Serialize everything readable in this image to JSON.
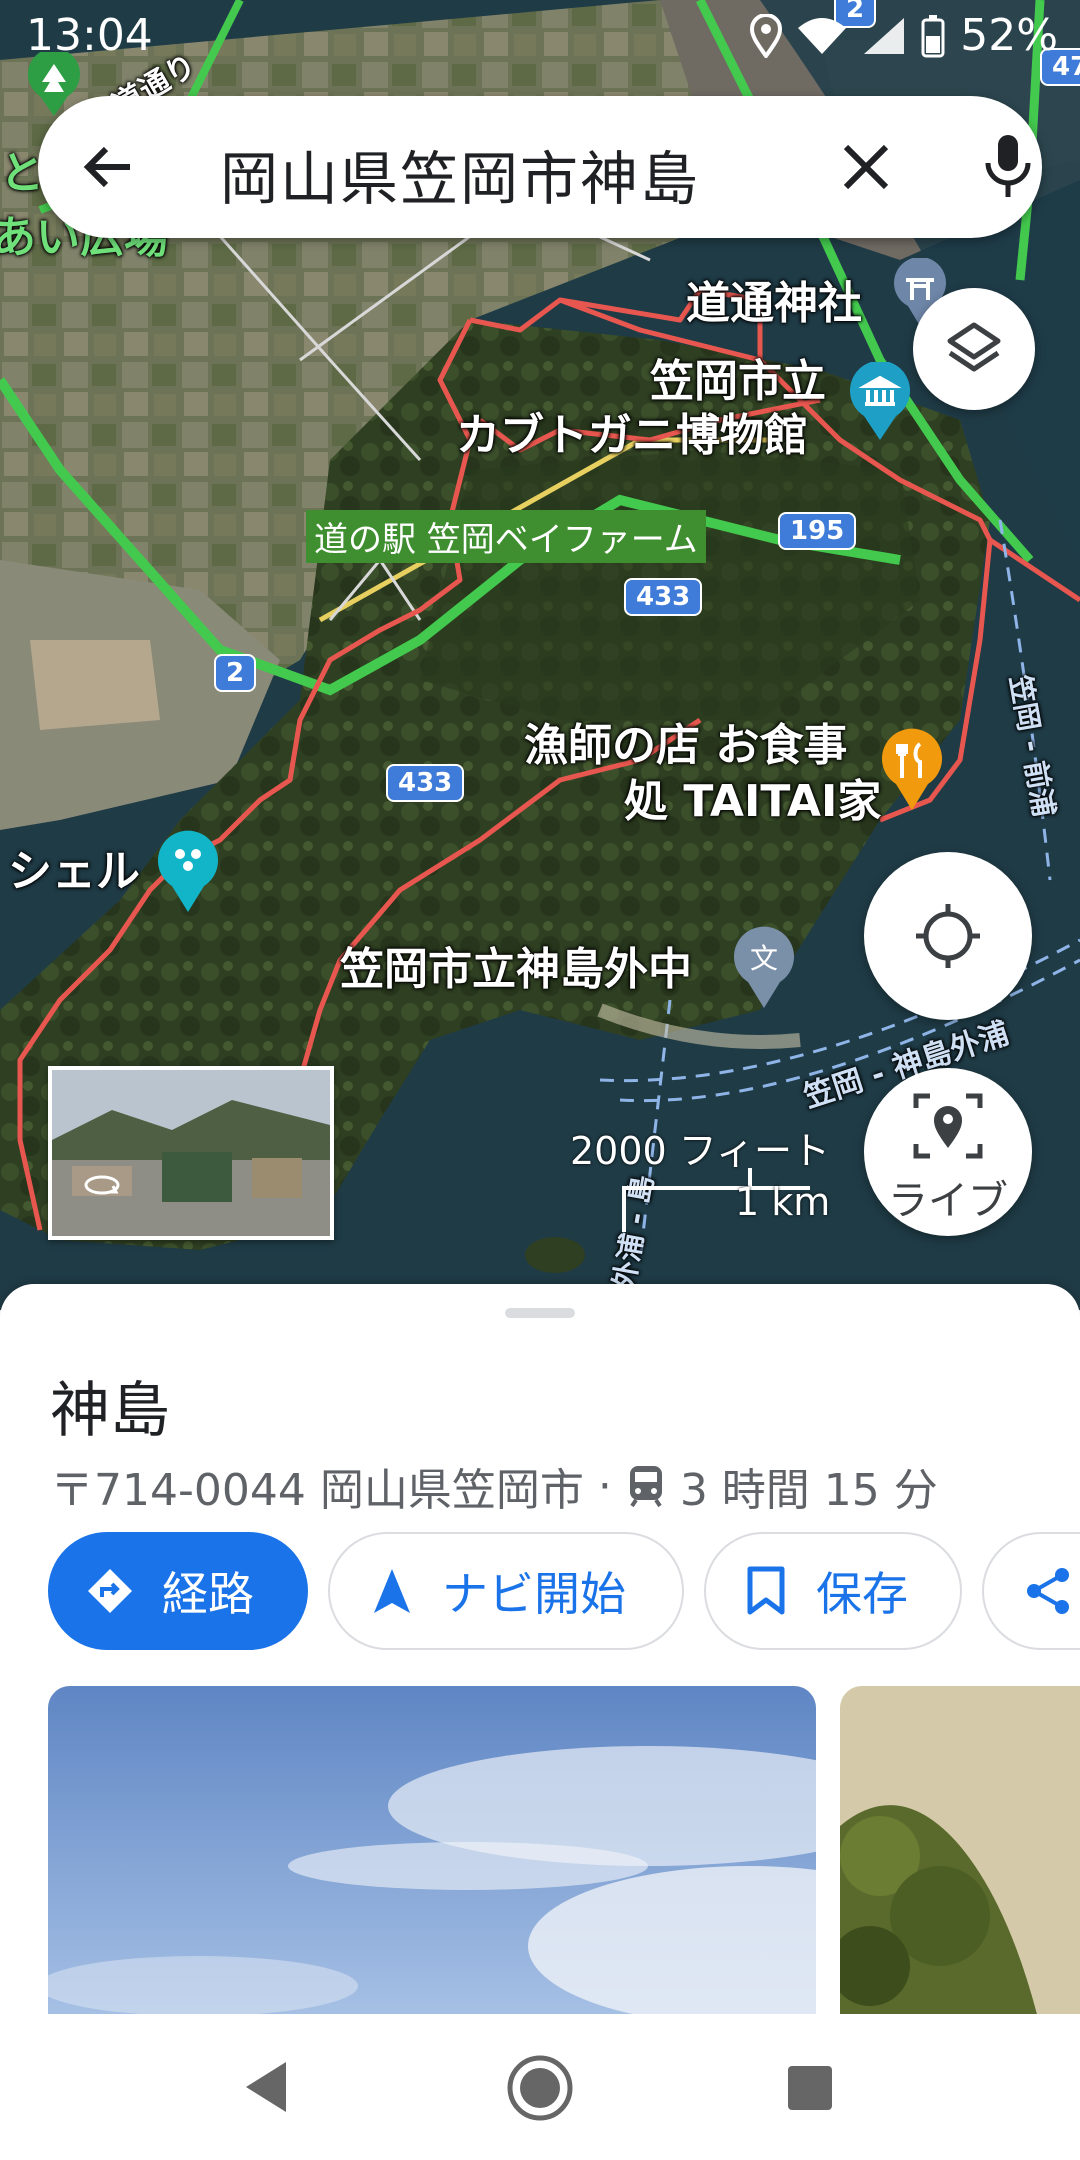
{
  "status_bar": {
    "time": "13:04",
    "battery": "52%"
  },
  "search": {
    "query": "岡山県笠岡市神島"
  },
  "map": {
    "labels": {
      "shrine": "道通神社",
      "museum_line1": "笠岡市立",
      "museum_line2": "カブトガニ博物館",
      "roadside_station": "道の駅 笠岡ベイファーム",
      "restaurant_line1": "漁師の店 お食事",
      "restaurant_line2": "処 TAITAI家",
      "shell": "シェル",
      "school": "笠岡市立神島外中",
      "fragment_road": "道通り",
      "fragment_park": "あい広場",
      "fragment_left": "と",
      "route_right": "笠岡 - 前浦",
      "route_bottom": "笠岡 - 神島外浦",
      "route_bottom2": "島外浦 - 島"
    },
    "road_shields": {
      "r195": "195",
      "r433a": "433",
      "r433b": "433",
      "r2": "2",
      "r47": "47",
      "r2top": "2"
    },
    "scale": {
      "feet": "2000 フィート",
      "km": "1 km"
    },
    "live_label": "ライブ"
  },
  "place": {
    "name": "神島",
    "address": "〒714-0044 岡山県笠岡市",
    "separator": "·",
    "transit_time": "3 時間 15 分"
  },
  "actions": {
    "directions": "経路",
    "navigate": "ナビ開始",
    "save": "保存"
  },
  "colors": {
    "accent": "#1a73e8",
    "route": "#e8574f",
    "road_green": "#43c94e",
    "water": "#1d3a46"
  }
}
